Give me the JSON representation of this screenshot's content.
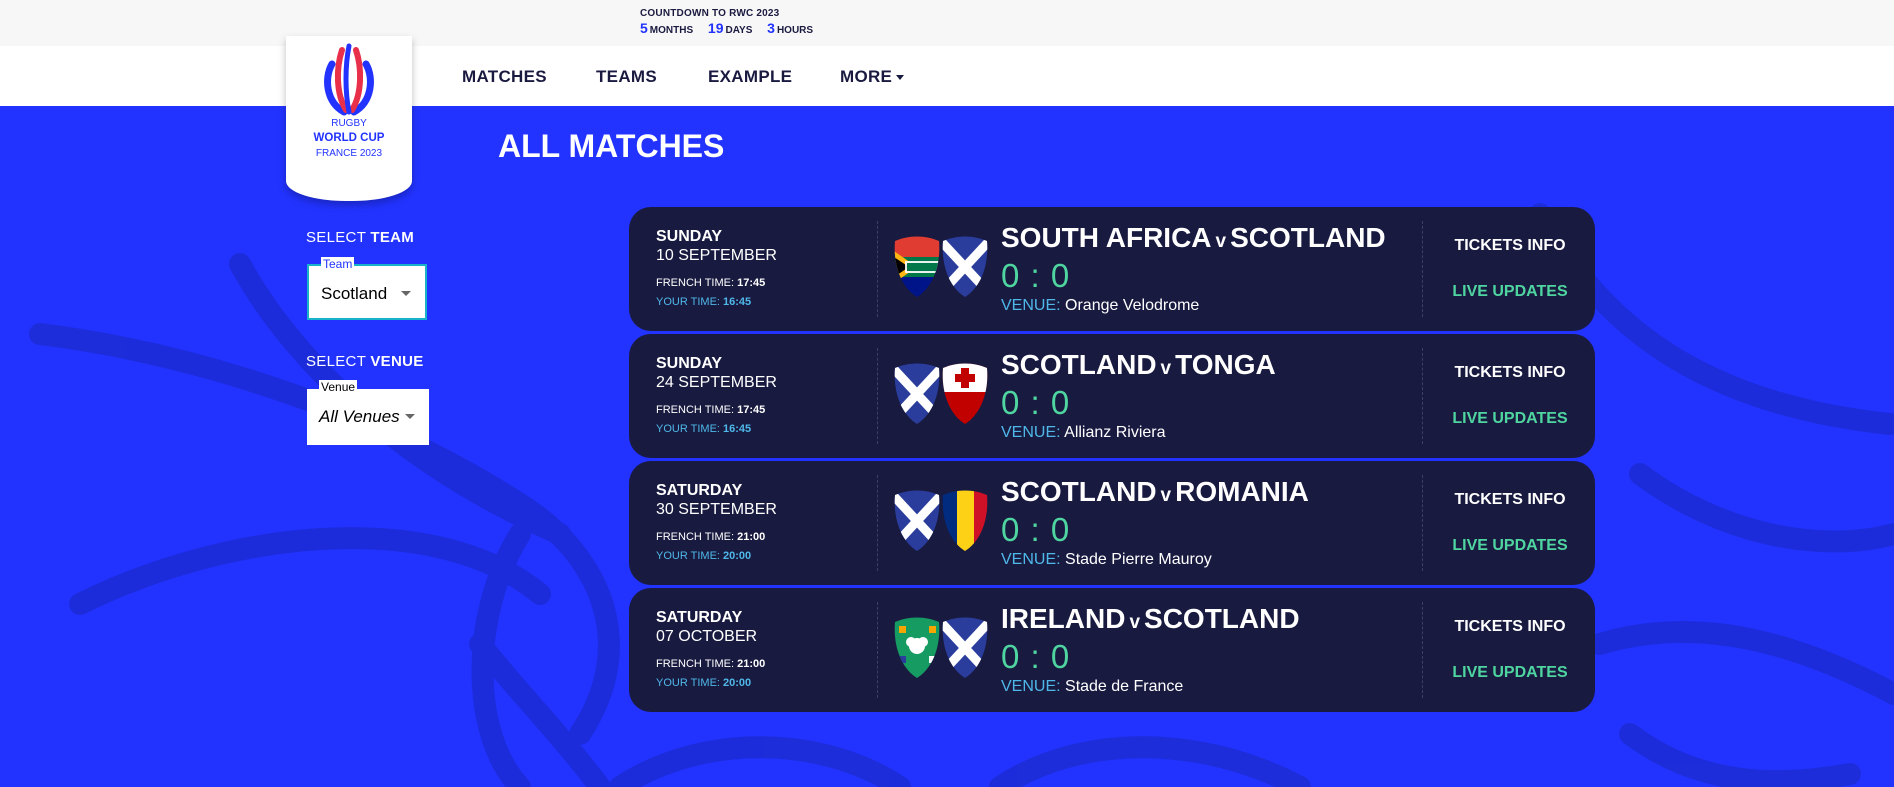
{
  "countdown": {
    "title": "COUNTDOWN TO RWC 2023",
    "months": "5",
    "months_unit": "MONTHS",
    "days": "19",
    "days_unit": "DAYS",
    "hours": "3",
    "hours_unit": "HOURS"
  },
  "nav": {
    "matches": "MATCHES",
    "teams": "TEAMS",
    "example": "EXAMPLE",
    "more": "MORE"
  },
  "logo": {
    "line1": "RUGBY",
    "line2": "WORLD CUP",
    "line3": "FRANCE 2023"
  },
  "page": {
    "title": "ALL MATCHES"
  },
  "filters": {
    "team_label_prefix": "SELECT ",
    "team_label_strong": "TEAM",
    "team_legend": "Team",
    "team_value": "Scotland",
    "venue_label_prefix": "SELECT ",
    "venue_label_strong": "VENUE",
    "venue_legend": "Venue",
    "venue_value": "All Venues"
  },
  "labels": {
    "french_time": "FRENCH TIME: ",
    "your_time": "YOUR TIME: ",
    "venue": "VENUE: ",
    "tickets": "TICKETS INFO",
    "live": "LIVE UPDATES",
    "versus": "v"
  },
  "matches": [
    {
      "day": "SUNDAY",
      "date": "10 SEPTEMBER",
      "french_time": "17:45",
      "your_time": "16:45",
      "home": "SOUTH AFRICA",
      "away": "SCOTLAND",
      "score": "0 : 0",
      "venue": "Orange Velodrome",
      "home_flag": "south-africa-flag-icon",
      "away_flag": "scotland-flag-icon"
    },
    {
      "day": "SUNDAY",
      "date": "24 SEPTEMBER",
      "french_time": "17:45",
      "your_time": "16:45",
      "home": "SCOTLAND",
      "away": "TONGA",
      "score": "0 : 0",
      "venue": "Allianz Riviera",
      "home_flag": "scotland-flag-icon",
      "away_flag": "tonga-flag-icon"
    },
    {
      "day": "SATURDAY",
      "date": "30 SEPTEMBER",
      "french_time": "21:00",
      "your_time": "20:00",
      "home": "SCOTLAND",
      "away": "ROMANIA",
      "score": "0 : 0",
      "venue": "Stade Pierre Mauroy",
      "home_flag": "scotland-flag-icon",
      "away_flag": "romania-flag-icon"
    },
    {
      "day": "SATURDAY",
      "date": "07 OCTOBER",
      "french_time": "21:00",
      "your_time": "20:00",
      "home": "IRELAND",
      "away": "SCOTLAND",
      "score": "0 : 0",
      "venue": "Stade de France",
      "home_flag": "ireland-flag-icon",
      "away_flag": "scotland-flag-icon"
    }
  ],
  "colors": {
    "brand_blue": "#2233ff",
    "card_navy": "#181a40",
    "score_green": "#4fd6a0",
    "accent_cyan": "#4fb8e8"
  }
}
